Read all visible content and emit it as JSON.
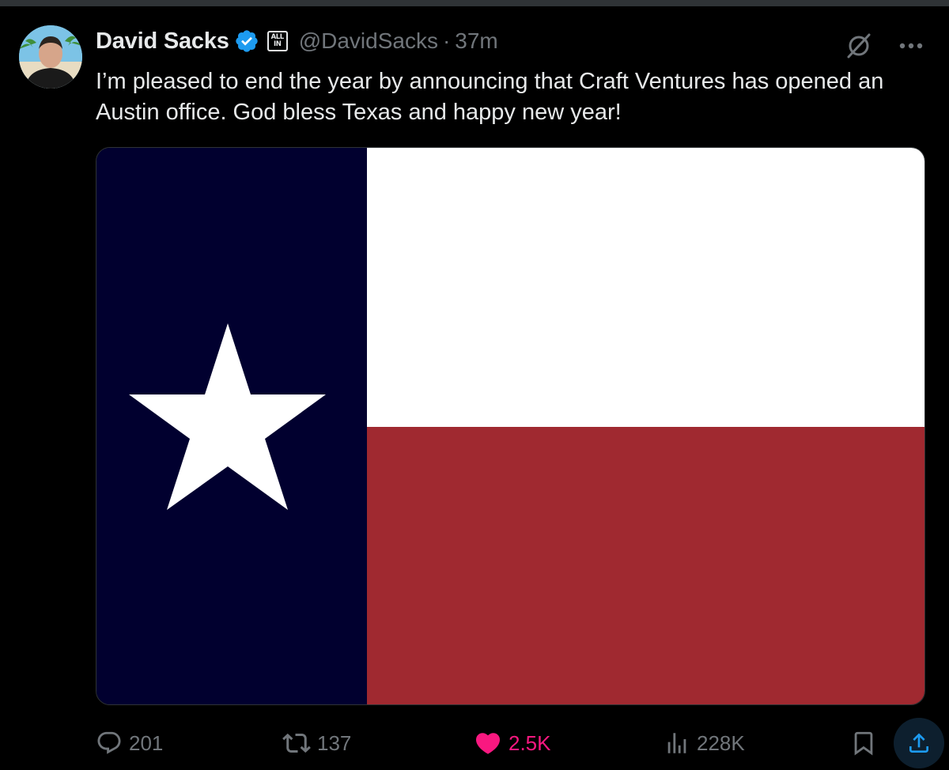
{
  "author": {
    "display_name": "David Sacks",
    "handle": "@DavidSacks",
    "separator": "·",
    "time": "37m",
    "affiliate_badge_line1": "ALL",
    "affiliate_badge_line2": "IN"
  },
  "tweet": {
    "text": "I’m pleased to end the year by announcing that Craft Ventures has opened an Austin office. God bless Texas and happy new year!"
  },
  "media": {
    "icon": "texas-flag"
  },
  "actions": {
    "replies": "201",
    "reposts": "137",
    "likes": "2.5K",
    "views": "228K"
  },
  "colors": {
    "background": "#000000",
    "text": "#e7e9ea",
    "muted": "#71767b",
    "verified": "#1d9bf0",
    "like": "#f91880",
    "share_accent": "#1d9bf0",
    "flag_blue": "#01002f",
    "flag_white": "#ffffff",
    "flag_red": "#a02930"
  }
}
